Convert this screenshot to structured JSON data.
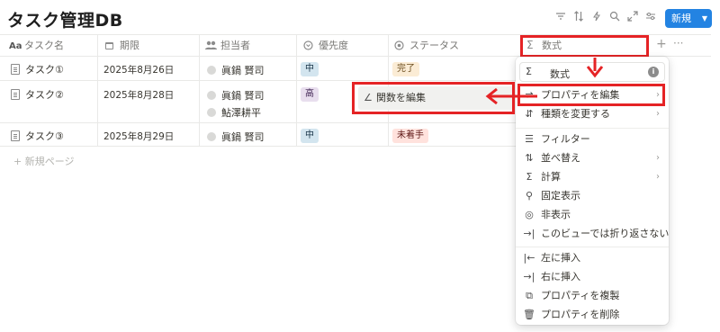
{
  "page": {
    "title": "タスク管理DB"
  },
  "toolbar": {
    "icons": [
      "filter-icon",
      "sort-icon",
      "lightning-icon",
      "search-icon",
      "expand-icon",
      "settings-icon"
    ],
    "new_button": "新規"
  },
  "columns": [
    {
      "label": "タスク名",
      "icon": "Aa"
    },
    {
      "label": "期限",
      "icon": "calendar-icon"
    },
    {
      "label": "担当者",
      "icon": "people-icon"
    },
    {
      "label": "優先度",
      "icon": "select-icon"
    },
    {
      "label": "ステータス",
      "icon": "status-icon"
    },
    {
      "label": "数式",
      "icon": "Σ"
    }
  ],
  "rows": [
    {
      "name": "タスク①",
      "date": "2025年8月26日",
      "assignees": [
        "眞鍋 賢司"
      ],
      "priority": "中",
      "status": "完了"
    },
    {
      "name": "タスク②",
      "date": "2025年8月28日",
      "assignees": [
        "眞鍋 賢司",
        "鮎澤耕平"
      ],
      "priority": "高",
      "status": ""
    },
    {
      "name": "タスク③",
      "date": "2025年8月29日",
      "assignees": [
        "眞鍋 賢司"
      ],
      "priority": "中",
      "status": "未着手"
    }
  ],
  "new_page_label": "+ 新規ページ",
  "colors": {
    "accent": "#2383e2",
    "highlight_red": "#e52325",
    "tag_mid_bg": "#d3e5ef",
    "tag_high_bg": "#e8deee",
    "tag_done_bg": "#fbecd5",
    "tag_todo_bg": "#ffe2dd"
  },
  "menu": {
    "header": {
      "icon": "Σ",
      "name": "数式"
    },
    "items": [
      {
        "label": "プロパティを編集",
        "has_arrow": true
      },
      {
        "label": "種類を変更する",
        "has_arrow": true
      },
      {
        "label": "フィルター",
        "has_arrow": false
      },
      {
        "label": "並べ替え",
        "has_arrow": true
      },
      {
        "label": "計算",
        "has_arrow": true
      },
      {
        "label": "固定表示",
        "has_arrow": false
      },
      {
        "label": "非表示",
        "has_arrow": false
      },
      {
        "label": "このビューでは折り返さない",
        "has_arrow": false
      },
      {
        "label": "左に挿入",
        "has_arrow": false
      },
      {
        "label": "右に挿入",
        "has_arrow": false
      },
      {
        "label": "プロパティを複製",
        "has_arrow": false
      },
      {
        "label": "プロパティを削除",
        "has_arrow": false
      }
    ]
  },
  "submenu": {
    "label": "関数を編集"
  }
}
